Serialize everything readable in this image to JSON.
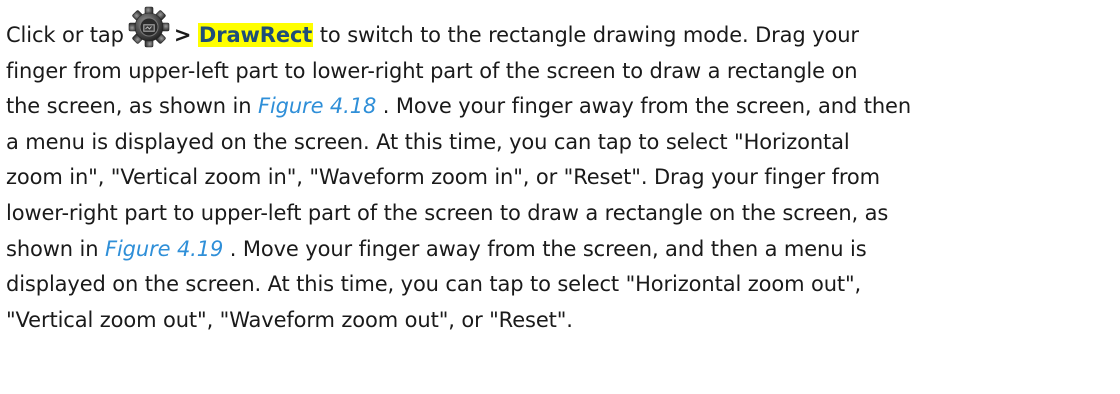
{
  "paragraph": {
    "l1_a": "Click or tap",
    "separator": ">",
    "menu_item": "DrawRect",
    "l1_b": "to switch to the rectangle drawing mode. Drag your",
    "l2": "finger from upper-left part to lower-right part of the screen to draw a rectangle on",
    "l3_a": "the screen, as shown in ",
    "figure_ref_1": "Figure 4.18",
    "l3_b": " . Move your finger away from the screen, and then",
    "l4": "a menu is displayed on the screen. At this time, you can tap to select \"Horizontal",
    "l5": "zoom in\", \"Vertical zoom in\", \"Waveform zoom in\", or \"Reset\". Drag your finger from",
    "l6": "lower-right part to upper-left part of the screen to draw a rectangle on the screen, as",
    "l7_a": "shown in ",
    "figure_ref_2": "Figure 4.19",
    "l7_b": " . Move your finger away from the screen, and then a menu is",
    "l8": "displayed on the screen. At this time, you can tap to select \"Horizontal zoom out\",",
    "l9": "\"Vertical zoom out\", \"Waveform zoom out\", or \"Reset\"."
  },
  "icons": {
    "settings": "gear-icon"
  },
  "colors": {
    "text": "#1a1a1a",
    "highlight_bg": "#ffff00",
    "highlight_text": "#1f4e79",
    "link": "#2f8fd8"
  }
}
